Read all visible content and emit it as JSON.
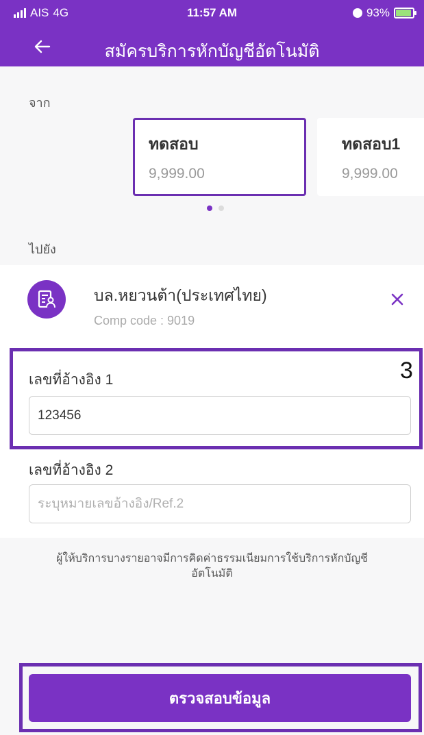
{
  "status_bar": {
    "carrier": "AIS",
    "network": "4G",
    "time": "11:57 AM",
    "battery": "93%"
  },
  "header": {
    "title": "สมัครบริการหักบัญชีอัตโนมัติ",
    "back_icon": "arrow-left-icon"
  },
  "from_section": {
    "label": "จาก",
    "accounts": [
      {
        "name": "ทดสอบ",
        "balance": "9,999.00",
        "selected": true
      },
      {
        "name": "ทดสอบ1",
        "balance": "9,999.00",
        "selected": false
      }
    ],
    "page_indicator": {
      "total": 2,
      "active": 1
    }
  },
  "to_section": {
    "label": "ไปยัง",
    "biller_name": "บล.หยวนต้า(ประเทศไทย)",
    "comp_code": "Comp code : 9019",
    "icon": "document-icon",
    "remove_icon": "close-icon"
  },
  "reference1": {
    "label": "เลขที่อ้างอิง 1",
    "value": "123456",
    "step_number": "3"
  },
  "reference2": {
    "label": "เลขที่อ้างอิง 2",
    "placeholder": "ระบุหมายเลขอ้างอิง/Ref.2",
    "value": ""
  },
  "note": "ผู้ให้บริการบางรายอาจมีการคิดค่าธรรมเนียมการใช้บริการหักบัญชีอัตโนมัติ",
  "submit_label": "ตรวจสอบข้อมูล",
  "colors": {
    "primary": "#7a32c4",
    "highlight": "#6b2fb1",
    "background_gray": "#f7f7f8"
  }
}
